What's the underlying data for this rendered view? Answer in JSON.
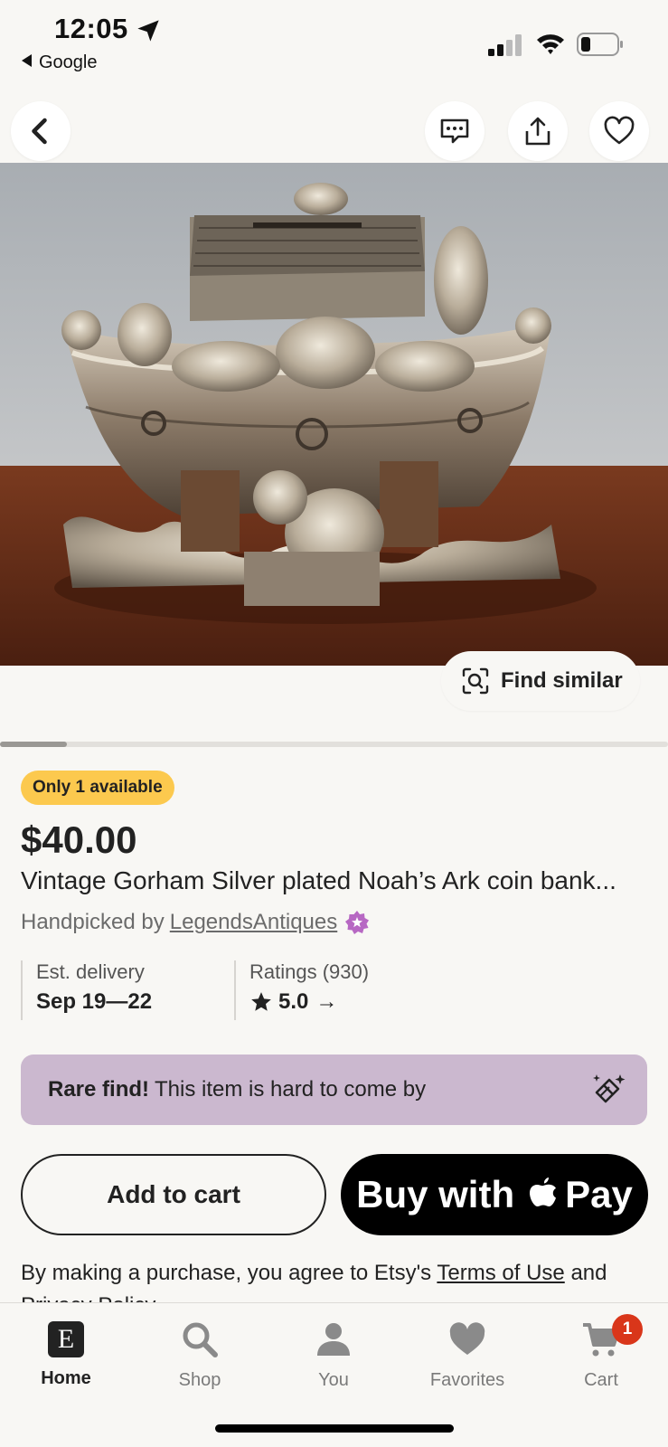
{
  "status_bar": {
    "time": "12:05",
    "back_app": "Google"
  },
  "hero": {
    "find_similar": "Find similar",
    "image_index_fraction": 0.1
  },
  "listing": {
    "availability": "Only 1 available",
    "price": "$40.00",
    "title": "Vintage Gorham Silver plated Noah’s Ark coin bank...",
    "handpicked_prefix": "Handpicked by",
    "shop_name": "LegendsAntiques",
    "delivery_label": "Est. delivery",
    "delivery_value": "Sep 19—22",
    "ratings_label": "Ratings (930)",
    "rating_value": "5.0",
    "rating_arrow": "→"
  },
  "rare": {
    "bold": "Rare find!",
    "text": "This item is hard to come by"
  },
  "actions": {
    "add_to_cart": "Add to cart",
    "buy_with": "Buy with",
    "pay": "Pay"
  },
  "legal": {
    "prefix": "By making a purchase, you agree to Etsy's",
    "terms": "Terms of Use",
    "and": "and",
    "privacy": "Privacy Policy"
  },
  "tabs": [
    {
      "label": "Home",
      "icon": "etsy-home-icon"
    },
    {
      "label": "Shop",
      "icon": "search-icon"
    },
    {
      "label": "You",
      "icon": "person-icon"
    },
    {
      "label": "Favorites",
      "icon": "heart-icon"
    },
    {
      "label": "Cart",
      "icon": "cart-icon"
    }
  ],
  "cart_count": "1",
  "colors": {
    "background": "#f8f7f4",
    "badge_yellow": "#fcc94e",
    "rare_purple": "#cbb8cf",
    "star_purple": "#b768c3",
    "cart_badge": "#d9361a"
  }
}
